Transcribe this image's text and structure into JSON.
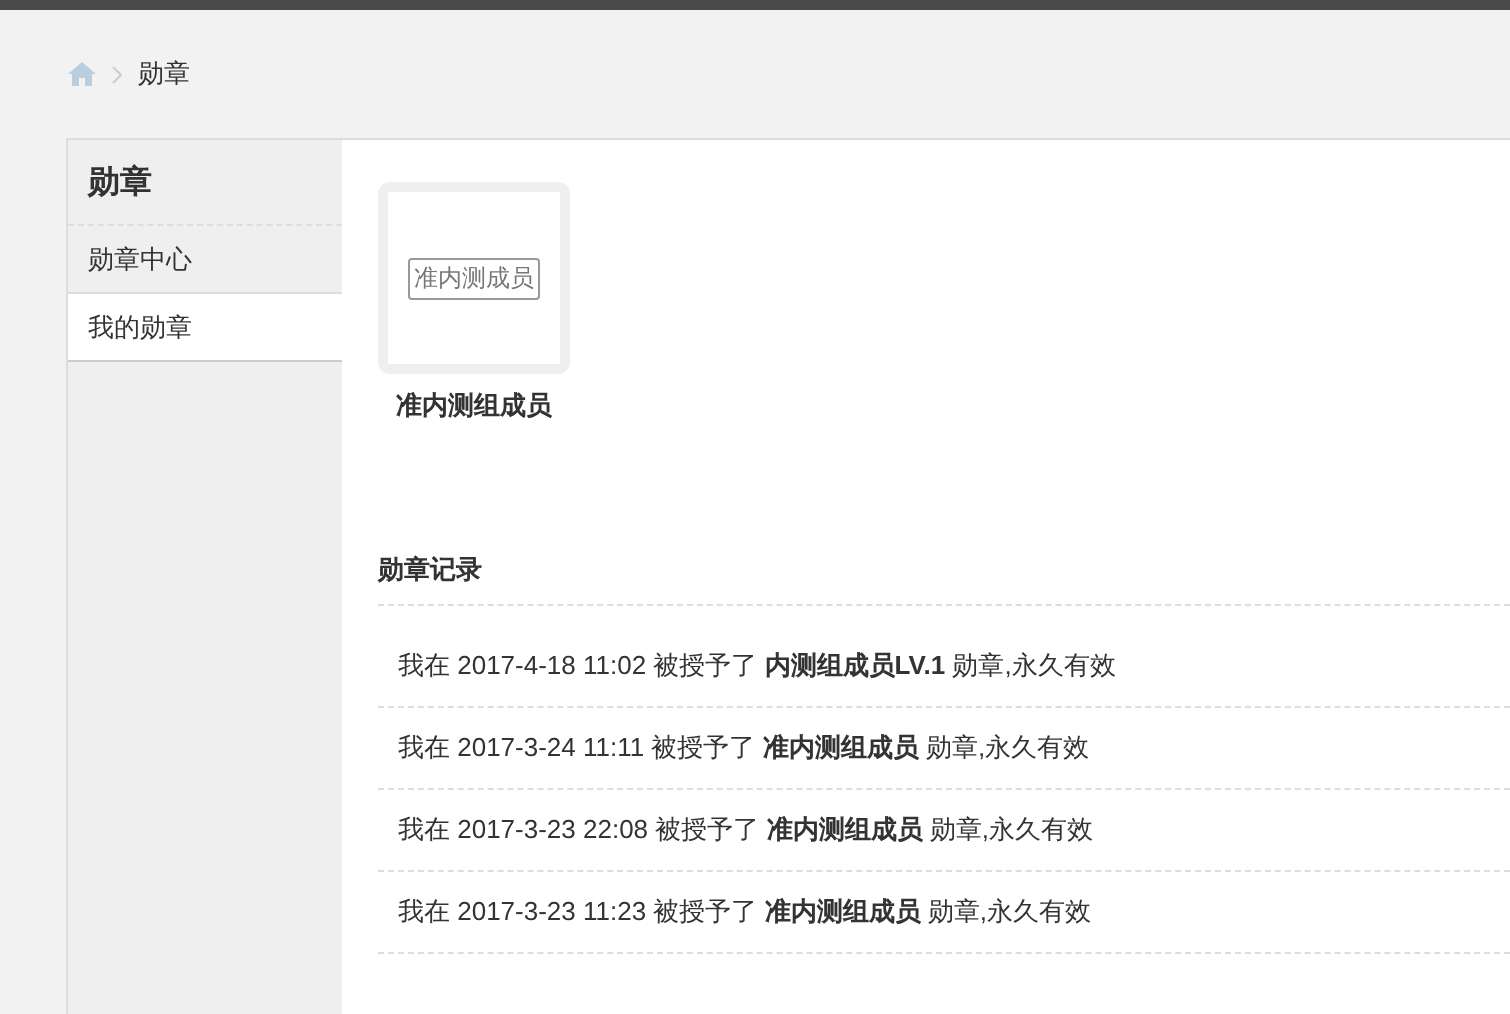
{
  "breadcrumb": {
    "current": "勋章"
  },
  "sidebar": {
    "title": "勋章",
    "items": [
      {
        "label": "勋章中心",
        "selected": false
      },
      {
        "label": "我的勋章",
        "selected": true
      }
    ]
  },
  "badges": [
    {
      "image_text": "准内测成员",
      "name": "准内测组成员"
    }
  ],
  "records": {
    "title": "勋章记录",
    "entries": [
      "我在 2017-4-18 11:02 被授予了 **内测组成员LV.1** 勋章,永久有效",
      "我在 2017-3-24 11:11 被授予了 **准内测组成员** 勋章,永久有效",
      "我在 2017-3-23 22:08 被授予了 **准内测组成员** 勋章,永久有效",
      "我在 2017-3-23 11:23 被授予了 **准内测组成员** 勋章,永久有效"
    ]
  }
}
